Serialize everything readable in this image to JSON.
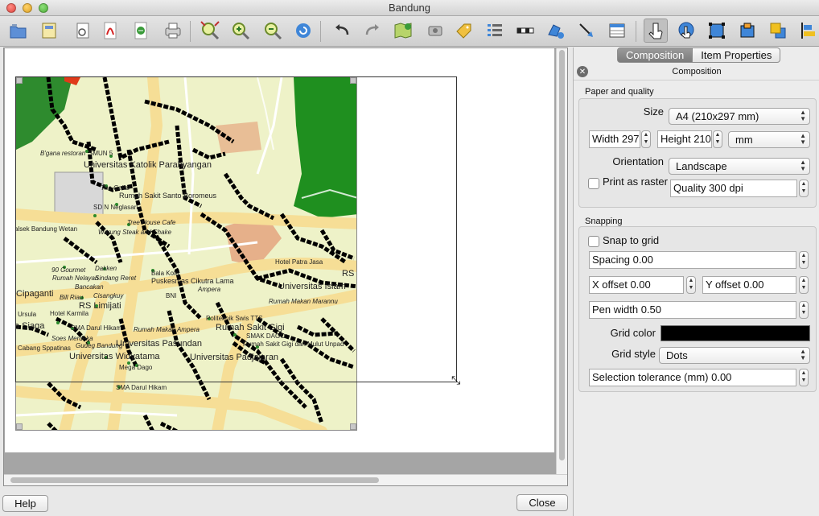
{
  "window": {
    "title": "Bandung"
  },
  "toolbar": {
    "icons": [
      "open-icon",
      "save-as-template-icon",
      "print-preview-icon",
      "export-pdf-icon",
      "export-svg-icon",
      "print-icon",
      "zoom-full-icon",
      "zoom-in-icon",
      "zoom-out-icon",
      "refresh-icon",
      "undo-icon",
      "redo-icon",
      "add-map-icon",
      "add-image-icon",
      "add-label-icon",
      "add-legend-icon",
      "add-scalebar-icon",
      "add-shape-icon",
      "add-arrow-icon",
      "add-table-icon",
      "select-move-item-icon",
      "move-item-content-icon",
      "group-icon",
      "ungroup-icon",
      "raise-icon",
      "align-icon"
    ]
  },
  "map": {
    "labels": [
      {
        "text": "B'gana restoran",
        "cls": "it"
      },
      {
        "text": "SMUN 5",
        "cls": ""
      },
      {
        "text": "Universitas Katolik Parahyangan",
        "cls": "big"
      },
      {
        "text": "The Cellar",
        "cls": "it"
      },
      {
        "text": "Rumah Sakit Santo Boromeus",
        "cls": ""
      },
      {
        "text": "SD N Neglasari",
        "cls": ""
      },
      {
        "text": "Tree House Cafe",
        "cls": "it"
      },
      {
        "text": "alsek Bandung Wetan",
        "cls": ""
      },
      {
        "text": "Warung Steak and Shake",
        "cls": "it"
      },
      {
        "text": "Hotel Patra Jasa",
        "cls": ""
      },
      {
        "text": "RS",
        "cls": ""
      },
      {
        "text": "90 Gourmet",
        "cls": "it"
      },
      {
        "text": "Dakken",
        "cls": "it"
      },
      {
        "text": "Bala Kota",
        "cls": ""
      },
      {
        "text": "Rumah Nelayan",
        "cls": "it"
      },
      {
        "text": "Sindang Reret",
        "cls": "it"
      },
      {
        "text": "Puskesmas Cikutra Lama",
        "cls": ""
      },
      {
        "text": "Universitas Islam",
        "cls": "big"
      },
      {
        "text": "Bancakan",
        "cls": "it"
      },
      {
        "text": "Ampera",
        "cls": "it"
      },
      {
        "text": "Cipaganti",
        "cls": "big"
      },
      {
        "text": "Bill Riau",
        "cls": "it"
      },
      {
        "text": "Cisangkuy",
        "cls": "it"
      },
      {
        "text": "BNI",
        "cls": ""
      },
      {
        "text": "Rumah Makan Marannu",
        "cls": "it"
      },
      {
        "text": "RS Limijati",
        "cls": "big"
      },
      {
        "text": "Ursula",
        "cls": ""
      },
      {
        "text": "Hotel Karmila",
        "cls": ""
      },
      {
        "text": "Politeknik Swis TTS",
        "cls": ""
      },
      {
        "text": "a Siaga",
        "cls": "big"
      },
      {
        "text": "SMA Darul Hikam",
        "cls": ""
      },
      {
        "text": "Rumah Makan Ampera",
        "cls": "it"
      },
      {
        "text": "Rumah Sakit Gigi",
        "cls": "big"
      },
      {
        "text": "Soes Merdeka",
        "cls": "it"
      },
      {
        "text": "SMAK DAGO",
        "cls": ""
      },
      {
        "text": "Universitas Pasundan",
        "cls": "big"
      },
      {
        "text": "Cabang Sppatinas",
        "cls": ""
      },
      {
        "text": "Gudeg Bandung",
        "cls": "it"
      },
      {
        "text": "Rumah Sakit Gigi dan Mulut Unpad",
        "cls": ""
      },
      {
        "text": "Universitas Widyatama",
        "cls": "big"
      },
      {
        "text": "Universitas Padjajaran",
        "cls": "big"
      },
      {
        "text": "Mega Dago",
        "cls": ""
      },
      {
        "text": "SMA Darul Hikam",
        "cls": ""
      }
    ]
  },
  "buttons": {
    "help": "Help",
    "close": "Close"
  },
  "panel": {
    "tabs": [
      "Composition",
      "Item Properties"
    ],
    "title": "Composition",
    "paper": {
      "group_title": "Paper and quality",
      "size_label": "Size",
      "size_value": "A4 (210x297 mm)",
      "width": "Width 297",
      "height": "Height 210",
      "units": "mm",
      "orientation_label": "Orientation",
      "orientation_value": "Landscape",
      "print_as_raster": "Print as raster",
      "quality": "Quality 300 dpi"
    },
    "snapping": {
      "group_title": "Snapping",
      "snap_to_grid": "Snap to grid",
      "spacing": "Spacing 0.00",
      "x_offset": "X offset 0.00",
      "y_offset": "Y offset 0.00",
      "pen_width": "Pen width 0.50",
      "grid_color_label": "Grid color",
      "grid_color": "#000000",
      "grid_style_label": "Grid style",
      "grid_style_value": "Dots",
      "selection_tolerance": "Selection tolerance (mm) 0.00"
    }
  }
}
